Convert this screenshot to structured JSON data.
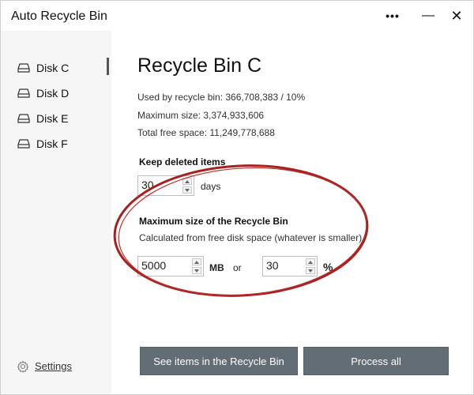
{
  "window": {
    "title": "Auto Recycle Bin",
    "more_label": "•••",
    "minimize_label": "—",
    "close_label": "✕"
  },
  "sidebar": {
    "items": [
      {
        "label": "Disk C",
        "icon": "drive-icon",
        "active": true
      },
      {
        "label": "Disk D",
        "icon": "drive-icon",
        "active": false
      },
      {
        "label": "Disk E",
        "icon": "drive-icon",
        "active": false
      },
      {
        "label": "Disk F",
        "icon": "drive-icon",
        "active": false
      }
    ],
    "settings_label": "Settings"
  },
  "main": {
    "title": "Recycle Bin C",
    "used_by_bin": "Used by recycle bin: 366,708,383 / 10%",
    "max_size": "Maximum size: 3,374,933,606",
    "total_free": "Total free space: 11,249,778,688",
    "keep_deleted": {
      "title": "Keep deleted items",
      "value": "30",
      "unit": "days"
    },
    "max_size_section": {
      "title": "Maximum size of the Recycle Bin",
      "subtitle": "Calculated from free disk space (whatever is smaller)",
      "mb_value": "5000",
      "mb_unit": "MB",
      "or_label": "or",
      "percent_value": "30",
      "percent_unit": "%"
    },
    "buttons": {
      "see_items": "See items in the Recycle Bin",
      "process_all": "Process all"
    }
  },
  "colors": {
    "sidebar_bg": "#f6f6f6",
    "button_bg": "#636d75",
    "annotation_red": "#a82020"
  }
}
